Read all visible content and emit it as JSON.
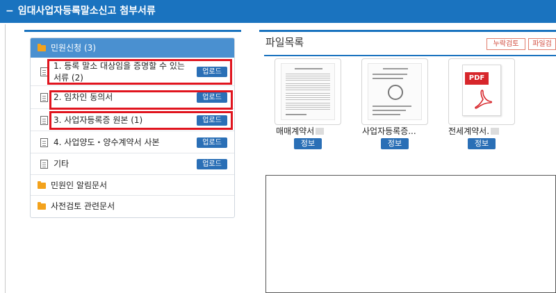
{
  "title": "임대사업자등록말소신고 첨부서류",
  "tree": {
    "root_label": "민원신청",
    "root_count": "(3)",
    "items": [
      {
        "label": "1. 등록 말소 대상임을 증명할 수 있는",
        "label2": "서류",
        "count": "(2)",
        "button": "업로드"
      },
      {
        "label": "2. 임차인 동의서",
        "count": "",
        "button": "업로드"
      },
      {
        "label": "3. 사업자등록증 원본",
        "count": "(1)",
        "button": "업로드"
      },
      {
        "label": "4. 사업양도・양수계약서 사본",
        "count": "",
        "button": "업로드"
      },
      {
        "label": "기타",
        "count": "",
        "button": "업로드"
      }
    ],
    "folders": [
      {
        "label": "민원인 알림문서"
      },
      {
        "label": "사전검토 관련문서"
      }
    ]
  },
  "files": {
    "title": "파일목록",
    "toolbar": [
      "누락검토",
      "파일검"
    ],
    "list": [
      {
        "name": "매매계약서",
        "type": "image",
        "info": "정보"
      },
      {
        "name": "사업자등록증...",
        "type": "image",
        "info": "정보"
      },
      {
        "name": "전세계약서.",
        "type": "pdf",
        "info": "정보",
        "badge": "PDF"
      }
    ]
  }
}
